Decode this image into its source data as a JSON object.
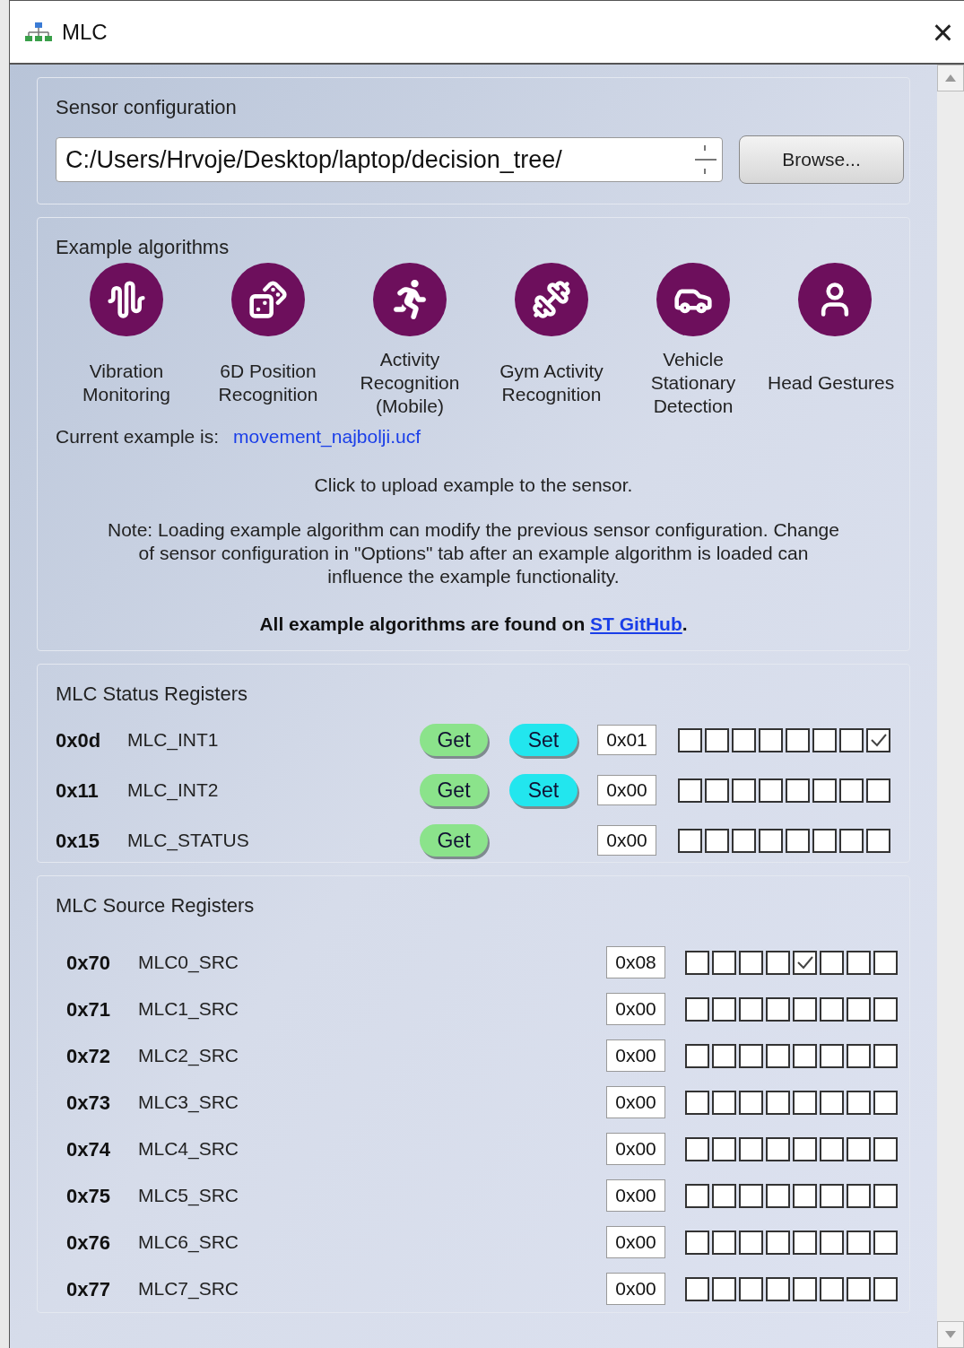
{
  "window": {
    "title": "MLC",
    "close": "×"
  },
  "sensor_configuration": {
    "title": "Sensor configuration",
    "path": "C:/Users/Hrvoje/Desktop/laptop/decision_tree/",
    "browse": "Browse..."
  },
  "example_algorithms": {
    "title": "Example algorithms",
    "items": [
      {
        "label": "Vibration Monitoring"
      },
      {
        "label": "6D Position Recognition"
      },
      {
        "label": "Activity Recognition (Mobile)"
      },
      {
        "label": "Gym Activity Recognition"
      },
      {
        "label": "Vehicle Stationary Detection"
      },
      {
        "label": "Head Gestures"
      }
    ],
    "current_label": "Current example is:",
    "current_file": "movement_najbolji.ucf",
    "hint": "Click to upload example to the sensor.",
    "note": "Note: Loading example algorithm can modify the previous sensor configuration. Change of sensor configuration in \"Options\" tab after an example algorithm is loaded can influence the example functionality.",
    "github_text": "All example algorithms are found on ",
    "github_link": "ST GitHub",
    "github_after": "."
  },
  "status_registers": {
    "title": "MLC Status Registers",
    "rows": [
      {
        "address": "0x0d",
        "name": "MLC_INT1",
        "buttons": [
          "Get",
          "Set"
        ],
        "value": "0x01",
        "bits": [
          {
            "checked": false
          },
          {
            "checked": false
          },
          {
            "checked": false
          },
          {
            "checked": false
          },
          {
            "checked": false
          },
          {
            "checked": false
          },
          {
            "checked": false
          },
          {
            "checked": true
          }
        ]
      },
      {
        "address": "0x11",
        "name": "MLC_INT2",
        "buttons": [
          "Get",
          "Set"
        ],
        "value": "0x00",
        "bits": [
          {
            "checked": false
          },
          {
            "checked": false
          },
          {
            "checked": false
          },
          {
            "checked": false
          },
          {
            "checked": false
          },
          {
            "checked": false
          },
          {
            "checked": false
          },
          {
            "checked": false
          }
        ]
      },
      {
        "address": "0x15",
        "name": "MLC_STATUS",
        "buttons": [
          "Get"
        ],
        "value": "0x00",
        "bits": [
          {
            "checked": false
          },
          {
            "checked": false
          },
          {
            "checked": false
          },
          {
            "checked": false
          },
          {
            "checked": false
          },
          {
            "checked": false
          },
          {
            "checked": false
          },
          {
            "checked": false
          }
        ]
      }
    ]
  },
  "source_registers": {
    "title": "MLC Source Registers",
    "rows": [
      {
        "address": "0x70",
        "name": "MLC0_SRC",
        "value": "0x08",
        "bits": [
          {
            "checked": false
          },
          {
            "checked": false
          },
          {
            "checked": false
          },
          {
            "checked": false
          },
          {
            "checked": true
          },
          {
            "checked": false
          },
          {
            "checked": false
          },
          {
            "checked": false
          }
        ]
      },
      {
        "address": "0x71",
        "name": "MLC1_SRC",
        "value": "0x00",
        "bits": [
          {
            "checked": false
          },
          {
            "checked": false
          },
          {
            "checked": false
          },
          {
            "checked": false
          },
          {
            "checked": false
          },
          {
            "checked": false
          },
          {
            "checked": false
          },
          {
            "checked": false
          }
        ]
      },
      {
        "address": "0x72",
        "name": "MLC2_SRC",
        "value": "0x00",
        "bits": [
          {
            "checked": false
          },
          {
            "checked": false
          },
          {
            "checked": false
          },
          {
            "checked": false
          },
          {
            "checked": false
          },
          {
            "checked": false
          },
          {
            "checked": false
          },
          {
            "checked": false
          }
        ]
      },
      {
        "address": "0x73",
        "name": "MLC3_SRC",
        "value": "0x00",
        "bits": [
          {
            "checked": false
          },
          {
            "checked": false
          },
          {
            "checked": false
          },
          {
            "checked": false
          },
          {
            "checked": false
          },
          {
            "checked": false
          },
          {
            "checked": false
          },
          {
            "checked": false
          }
        ]
      },
      {
        "address": "0x74",
        "name": "MLC4_SRC",
        "value": "0x00",
        "bits": [
          {
            "checked": false
          },
          {
            "checked": false
          },
          {
            "checked": false
          },
          {
            "checked": false
          },
          {
            "checked": false
          },
          {
            "checked": false
          },
          {
            "checked": false
          },
          {
            "checked": false
          }
        ]
      },
      {
        "address": "0x75",
        "name": "MLC5_SRC",
        "value": "0x00",
        "bits": [
          {
            "checked": false
          },
          {
            "checked": false
          },
          {
            "checked": false
          },
          {
            "checked": false
          },
          {
            "checked": false
          },
          {
            "checked": false
          },
          {
            "checked": false
          },
          {
            "checked": false
          }
        ]
      },
      {
        "address": "0x76",
        "name": "MLC6_SRC",
        "value": "0x00",
        "bits": [
          {
            "checked": false
          },
          {
            "checked": false
          },
          {
            "checked": false
          },
          {
            "checked": false
          },
          {
            "checked": false
          },
          {
            "checked": false
          },
          {
            "checked": false
          },
          {
            "checked": false
          }
        ]
      },
      {
        "address": "0x77",
        "name": "MLC7_SRC",
        "value": "0x00",
        "bits": [
          {
            "checked": false
          },
          {
            "checked": false
          },
          {
            "checked": false
          },
          {
            "checked": false
          },
          {
            "checked": false
          },
          {
            "checked": false
          },
          {
            "checked": false
          },
          {
            "checked": false
          }
        ]
      }
    ]
  }
}
